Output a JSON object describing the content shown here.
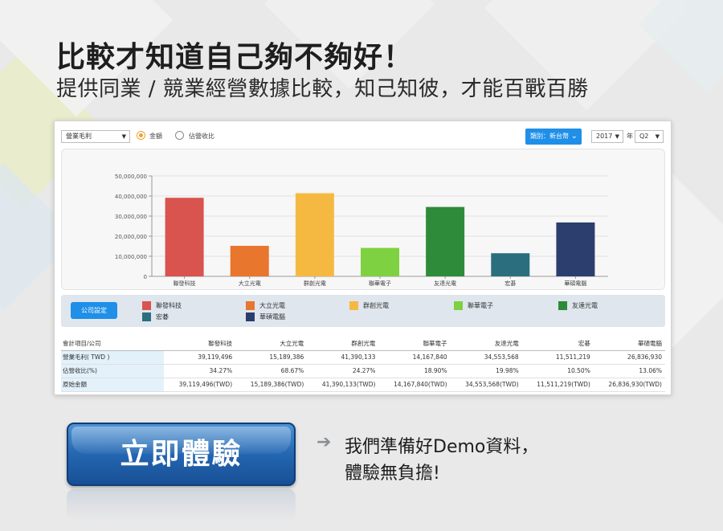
{
  "headline": "比較才知道自己夠不夠好！",
  "subline": "提供同業 / 競業經營數據比較，知己知彼，才能百戰百勝",
  "toolbar": {
    "metric_select": "營業毛利",
    "radio_amount": "金額",
    "radio_ratio": "佔營收比",
    "radio_selected": "金額",
    "category_button": "類別：新台幣",
    "year_select": "2017",
    "year_label": "年",
    "quarter_select": "Q2"
  },
  "chart_data": {
    "type": "bar",
    "categories": [
      "聯發科技",
      "大立光電",
      "群創光電",
      "聯華電子",
      "友達光電",
      "宏碁",
      "華碩電腦"
    ],
    "values": [
      39119496,
      15189386,
      41390133,
      14167840,
      34553568,
      11511219,
      26836930
    ],
    "colors": [
      "#d9534f",
      "#e8762c",
      "#f5b942",
      "#7ed140",
      "#2e8b3a",
      "#2b6e7e",
      "#2c3e6e"
    ],
    "yticks": [
      "0",
      "10,000,000",
      "20,000,000",
      "30,000,000",
      "40,000,000",
      "50,000,000"
    ],
    "ylim": [
      0,
      50000000
    ]
  },
  "legend": {
    "setting_button": "公司設定",
    "items": [
      "聯發科技",
      "大立光電",
      "群創光電",
      "聯華電子",
      "友達光電",
      "宏碁",
      "華碩電腦"
    ]
  },
  "table": {
    "header": [
      "會計項目/公司",
      "聯發科技",
      "大立光電",
      "群創光電",
      "聯華電子",
      "友達光電",
      "宏碁",
      "華碩電腦"
    ],
    "rows": [
      [
        "營業毛利( TWD )",
        "39,119,496",
        "15,189,386",
        "41,390,133",
        "14,167,840",
        "34,553,568",
        "11,511,219",
        "26,836,930"
      ],
      [
        "佔營收比(%)",
        "34.27%",
        "68.67%",
        "24.27%",
        "18.90%",
        "19.98%",
        "10.50%",
        "13.06%"
      ],
      [
        "原始金額",
        "39,119,496(TWD)",
        "15,189,386(TWD)",
        "41,390,133(TWD)",
        "14,167,840(TWD)",
        "34,553,568(TWD)",
        "11,511,219(TWD)",
        "26,836,930(TWD)"
      ]
    ]
  },
  "cta": {
    "button_label": "立即體驗",
    "line1": "我們準備好Demo資料，",
    "line2": "體驗無負擔!"
  }
}
